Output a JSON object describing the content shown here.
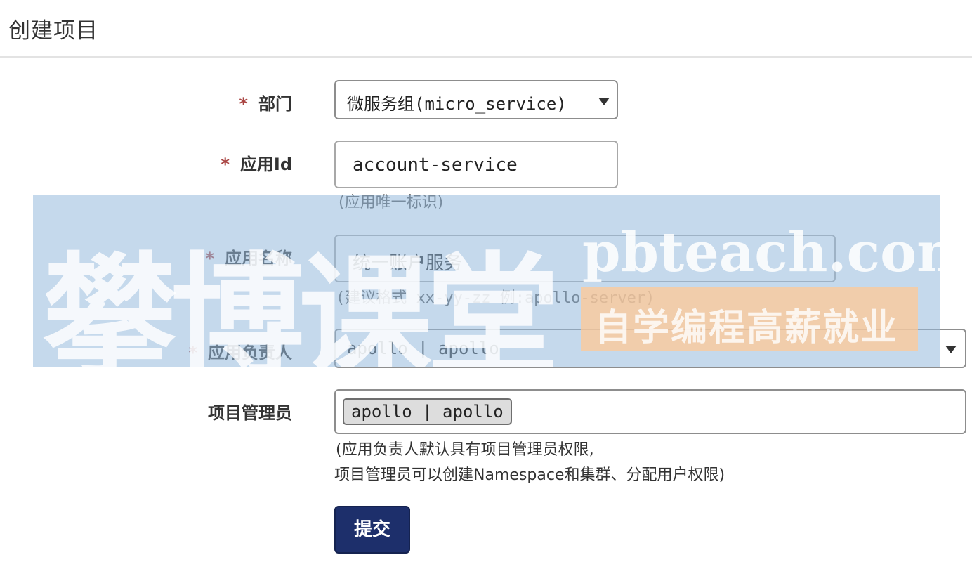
{
  "page": {
    "title": "创建项目"
  },
  "form": {
    "department": {
      "label": "部门",
      "required_mark": "*",
      "value": "微服务组(micro_service)"
    },
    "app_id": {
      "label": "应用Id",
      "required_mark": "*",
      "value": "account-service",
      "help": "(应用唯一标识)"
    },
    "app_name": {
      "label": "应用名称",
      "required_mark": "*",
      "value": "统一账户服务",
      "help": "(建议格式 xx-yy-zz 例:apollo-server)"
    },
    "owner": {
      "label": "应用负责人",
      "required_mark": "*",
      "value": "apollo | apollo"
    },
    "admins": {
      "label": "项目管理员",
      "tags": [
        "apollo | apollo"
      ],
      "help_line1": "(应用负责人默认具有项目管理员权限,",
      "help_line2": "项目管理员可以创建Namespace和集群、分配用户权限)"
    },
    "submit_label": "提交"
  },
  "watermark": {
    "brand_cn": "攀博课堂",
    "brand_en": "pbteach.com",
    "slogan": "自学编程高薪就业"
  },
  "colors": {
    "primary_button": "#1d2f6b",
    "required_mark": "#a94442",
    "watermark_blue": "#96b9dc",
    "watermark_orange": "#ffc896"
  }
}
